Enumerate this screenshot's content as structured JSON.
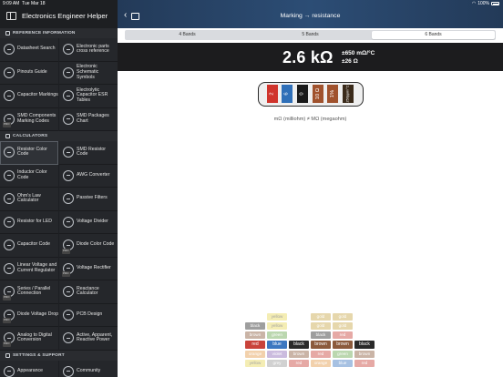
{
  "status": {
    "time": "9:09 AM",
    "date": "Tue Mar 18",
    "battery": "100%"
  },
  "app_title": "Electronics Engineer Helper",
  "sections": {
    "reference": "REFERENCE INFORMATION",
    "calculators": "CALCULATORS",
    "settings": "SETTINGS & SUPPORT"
  },
  "reference_items": [
    {
      "label": "Datasheet Search",
      "icon": "datasheet-icon"
    },
    {
      "label": "Electronic parts cross reference",
      "icon": "cross-reference-icon"
    },
    {
      "label": "Pinouts Guide",
      "icon": "pinout-icon"
    },
    {
      "label": "Electronic Schematic Symbols",
      "icon": "schematic-icon"
    },
    {
      "label": "Capacitor Markings",
      "icon": "capacitor-icon"
    },
    {
      "label": "Electrolytic Capacitor ESR Tables",
      "icon": "esr-icon"
    },
    {
      "label": "SMD Components Marking Codes",
      "icon": "smd-icon",
      "pro": "PRO"
    },
    {
      "label": "SMD Packages Chart",
      "icon": "package-icon"
    }
  ],
  "calculator_items": [
    {
      "label": "Resistor Color Code",
      "icon": "resistor-icon",
      "selected": true
    },
    {
      "label": "SMD Resistor Code",
      "icon": "smd-resistor-icon"
    },
    {
      "label": "Inductor Color Code",
      "icon": "inductor-icon"
    },
    {
      "label": "AWG Converter",
      "icon": "awg-icon"
    },
    {
      "label": "Ohm's Law Calculator",
      "icon": "ohm-icon"
    },
    {
      "label": "Passive Filters",
      "icon": "filter-icon"
    },
    {
      "label": "Resistor for LED",
      "icon": "led-icon"
    },
    {
      "label": "Voltage Divider",
      "icon": "divider-icon"
    },
    {
      "label": "Capacitor Code",
      "icon": "capacitor-code-icon"
    },
    {
      "label": "Diode Color Code",
      "icon": "diode-icon",
      "pro": "PRO"
    },
    {
      "label": "Linear Voltage and Current Regulator",
      "icon": "regulator-icon"
    },
    {
      "label": "Voltage Rectifier",
      "icon": "rectifier-icon",
      "pro": "PRO"
    },
    {
      "label": "Series / Parallel Connection",
      "icon": "series-icon",
      "pro": "PRO"
    },
    {
      "label": "Reactance Calculator",
      "icon": "reactance-icon"
    },
    {
      "label": "Diode Voltage Drop",
      "icon": "diode-drop-icon",
      "pro": "PRO"
    },
    {
      "label": "PCB Design",
      "icon": "pcb-icon"
    },
    {
      "label": "Analog to Digital Conversion",
      "icon": "adc-icon",
      "pro": "PRO"
    },
    {
      "label": "Active, Apparent, Reactive Power",
      "icon": "power-icon"
    }
  ],
  "settings_items": [
    {
      "label": "Appearance",
      "icon": "appearance-icon"
    },
    {
      "label": "Community",
      "icon": "community-icon"
    }
  ],
  "nav": {
    "title": "Marking → resistance"
  },
  "tabs": [
    {
      "label": "4 Bands",
      "active": false
    },
    {
      "label": "5 Bands",
      "active": false
    },
    {
      "label": "6 Bands",
      "active": true
    }
  ],
  "result": {
    "value": "2.6 kΩ",
    "tol1": "±650 mΩ/°C",
    "tol2": "±26 Ω"
  },
  "bands": [
    {
      "text": "2",
      "color": "#d0342c"
    },
    {
      "text": "6",
      "color": "#2f6fb8"
    },
    {
      "text": "0",
      "color": "#1a1a1a"
    },
    {
      "text": "10 Ω",
      "color": "#a0522d"
    },
    {
      "text": "1%",
      "color": "#a0522d"
    },
    {
      "text": "250ppm/°C",
      "color": "#3a2a1a"
    }
  ],
  "note": "mΩ (milliohm) ≠ MΩ (megaohm)",
  "picker_rows": [
    [
      "",
      "",
      "",
      "",
      "",
      ""
    ],
    [
      "",
      "yellow",
      "",
      "gold",
      "gold",
      ""
    ],
    [
      "black",
      "yellow",
      "",
      "gold",
      "gold",
      ""
    ],
    [
      "brown",
      "green",
      "",
      "black",
      "red",
      ""
    ],
    [
      "red",
      "blue",
      "black",
      "brown",
      "brown",
      "black"
    ],
    [
      "orange",
      "violet",
      "brown",
      "red",
      "green",
      "brown"
    ],
    [
      "yellow",
      "grey",
      "red",
      "orange",
      "blue",
      "red"
    ],
    [
      "",
      "",
      "",
      "",
      "",
      ""
    ]
  ]
}
